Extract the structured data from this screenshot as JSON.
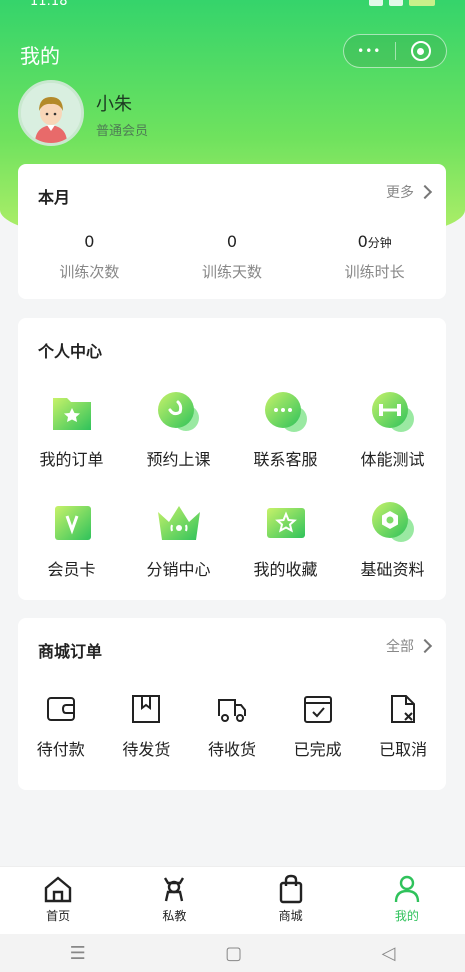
{
  "status_bar": {
    "time": "11:18"
  },
  "header": {
    "title": "我的",
    "capsule": {
      "more": "•••"
    }
  },
  "user": {
    "name": "小朱",
    "level": "普通会员"
  },
  "month_card": {
    "title": "本月",
    "more": "更多",
    "stats": [
      {
        "value": "0",
        "unit": "",
        "label": "训练次数"
      },
      {
        "value": "0",
        "unit": "",
        "label": "训练天数"
      },
      {
        "value": "0",
        "unit": "分钟",
        "label": "训练时长"
      }
    ]
  },
  "personal_center": {
    "title": "个人中心",
    "items": [
      {
        "label": "我的订单",
        "icon": "order-folder-icon"
      },
      {
        "label": "预约上课",
        "icon": "booking-icon"
      },
      {
        "label": "联系客服",
        "icon": "chat-icon"
      },
      {
        "label": "体能测试",
        "icon": "dumbbell-icon"
      },
      {
        "label": "会员卡",
        "icon": "member-card-icon"
      },
      {
        "label": "分销中心",
        "icon": "crown-icon"
      },
      {
        "label": "我的收藏",
        "icon": "star-collection-icon"
      },
      {
        "label": "基础资料",
        "icon": "hex-nut-icon"
      }
    ]
  },
  "mall_orders": {
    "title": "商城订单",
    "more": "全部",
    "items": [
      {
        "label": "待付款",
        "icon": "wallet-icon"
      },
      {
        "label": "待发货",
        "icon": "package-icon"
      },
      {
        "label": "待收货",
        "icon": "truck-icon"
      },
      {
        "label": "已完成",
        "icon": "calendar-check-icon"
      },
      {
        "label": "已取消",
        "icon": "doc-cancel-icon"
      }
    ]
  },
  "tabbar": {
    "items": [
      {
        "label": "首页",
        "icon": "home-icon",
        "active": false
      },
      {
        "label": "私教",
        "icon": "coach-icon",
        "active": false
      },
      {
        "label": "商城",
        "icon": "shopping-bag-icon",
        "active": false
      },
      {
        "label": "我的",
        "icon": "person-icon",
        "active": true
      }
    ]
  },
  "colors": {
    "accent": "#2fc25b",
    "header_top": "#35d46b",
    "header_bottom": "#b9f06a"
  }
}
